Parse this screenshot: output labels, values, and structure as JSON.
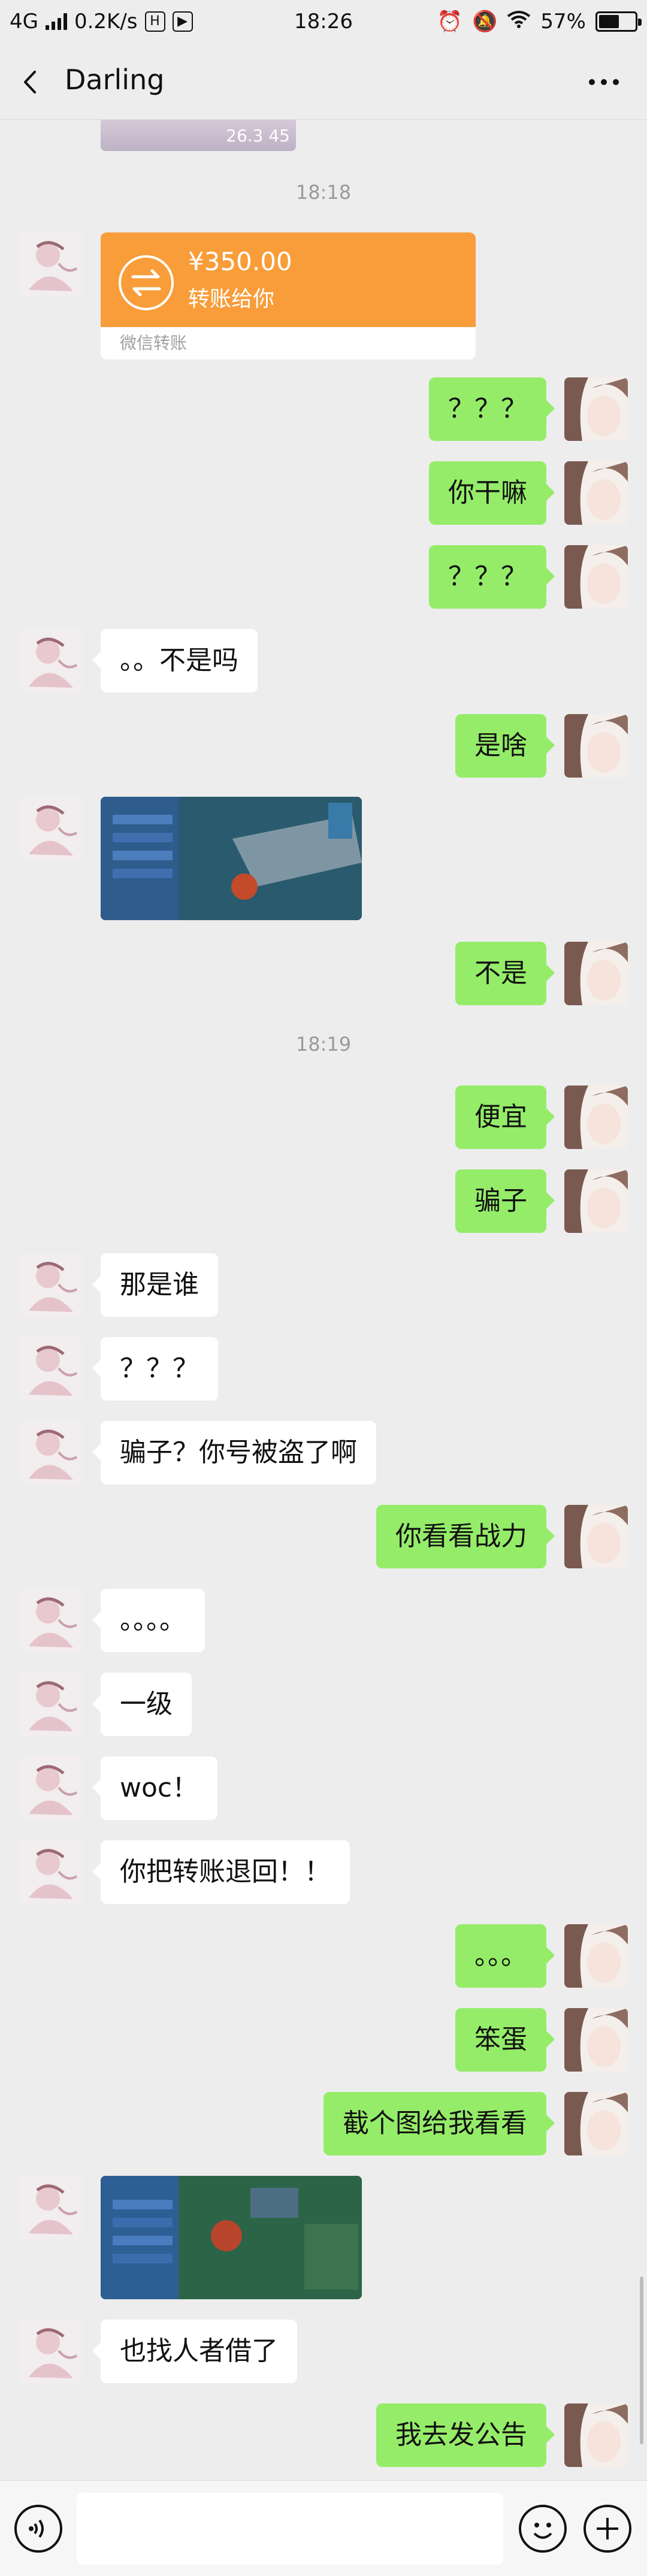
{
  "status_bar": {
    "network": "4G",
    "speed": "0.2K/s",
    "time": "18:26",
    "battery": "57%",
    "battery_level": 0.57
  },
  "header": {
    "title": "Darling"
  },
  "prev_image": {
    "caption": "26.3 45"
  },
  "timestamps": [
    "18:18",
    "18:19"
  ],
  "transfer": {
    "amount": "¥350.00",
    "note": "转账给你",
    "footer": "微信转账"
  },
  "messages": [
    {
      "side": "right",
      "text": "？？？"
    },
    {
      "side": "right",
      "text": "你干嘛"
    },
    {
      "side": "right",
      "text": "？？？"
    },
    {
      "side": "left",
      "text": "。。不是吗"
    },
    {
      "side": "right",
      "text": "是啥"
    },
    {
      "side": "left",
      "type": "image"
    },
    {
      "side": "right",
      "text": "不是"
    },
    {
      "side": "right",
      "text": "便宜"
    },
    {
      "side": "right",
      "text": "骗子"
    },
    {
      "side": "left",
      "text": "那是谁"
    },
    {
      "side": "left",
      "text": "？？？"
    },
    {
      "side": "left",
      "text": "骗子？你号被盗了啊"
    },
    {
      "side": "right",
      "text": "你看看战力"
    },
    {
      "side": "left",
      "text": "。。。。"
    },
    {
      "side": "left",
      "text": "一级"
    },
    {
      "side": "left",
      "text": "woc！"
    },
    {
      "side": "left",
      "text": "你把转账退回！！"
    },
    {
      "side": "right",
      "text": "。。。"
    },
    {
      "side": "right",
      "text": "笨蛋"
    },
    {
      "side": "right",
      "text": "截个图给我看看"
    },
    {
      "side": "left",
      "type": "image"
    },
    {
      "side": "left",
      "text": "也找人者借了"
    },
    {
      "side": "right",
      "text": "我去发公告"
    }
  ],
  "input": {
    "placeholder": ""
  },
  "colors": {
    "sent_bubble": "#95EC69",
    "received_bubble": "#FFFFFF",
    "transfer": "#F89D3A",
    "background": "#EDEDED"
  },
  "icons": [
    "back-arrow-icon",
    "more-icon",
    "voice-icon",
    "emoji-icon",
    "plus-icon",
    "transfer-icon"
  ]
}
